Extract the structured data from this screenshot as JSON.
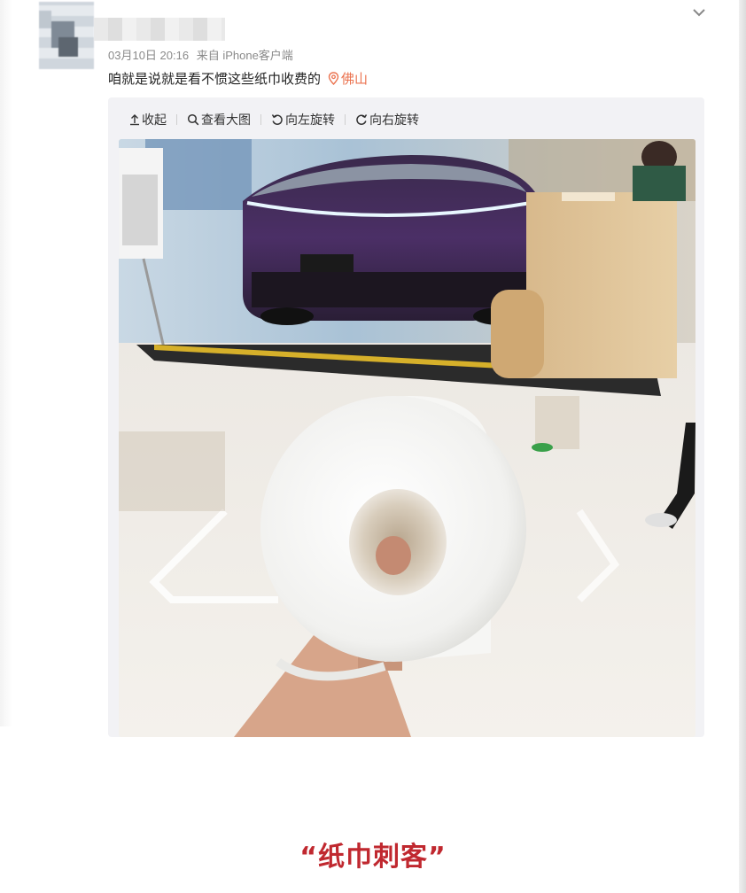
{
  "post": {
    "timestamp": "03月10日 20:16",
    "source": "来自 iPhone客户端",
    "text": "咱就是说就是看不惯这些纸巾收费的",
    "location": "佛山",
    "location_color": "#eb7350"
  },
  "toolbar": {
    "collapse_label": "收起",
    "view_large_label": "查看大图",
    "rotate_left_label": "向左旋转",
    "rotate_right_label": "向右旋转"
  },
  "icons": {
    "menu": "chevron-down-icon",
    "location": "map-pin-icon",
    "collapse": "collapse-icon",
    "zoom": "search-icon",
    "rotate_left": "rotate-left-icon",
    "rotate_right": "rotate-right-icon"
  },
  "caption": {
    "text": "“纸巾刺客”",
    "color": "#c0282f"
  }
}
